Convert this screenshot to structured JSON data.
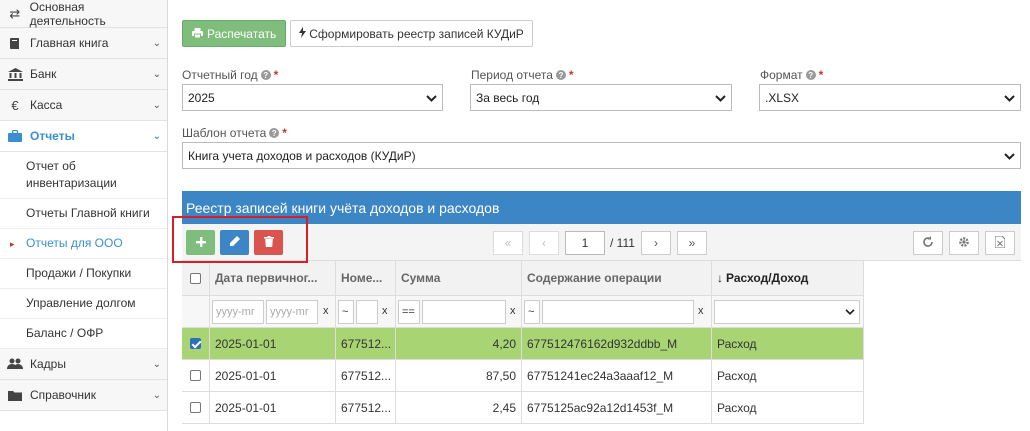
{
  "sidebar": {
    "top": {
      "label": "Основная деятельность",
      "icon": "transfer-arrows-icon"
    },
    "items": [
      {
        "label": "Главная книга",
        "icon": "book-icon"
      },
      {
        "label": "Банк",
        "icon": "bank-icon"
      },
      {
        "label": "Касса",
        "icon": "euro-icon"
      },
      {
        "label": "Отчеты",
        "icon": "briefcase-icon"
      }
    ],
    "subitems": [
      {
        "label": "Отчет об инвентаризации"
      },
      {
        "label": "Отчеты Главной книги"
      },
      {
        "label": "Отчеты для ООО"
      },
      {
        "label": "Продажи / Покупки"
      },
      {
        "label": "Управление долгом"
      },
      {
        "label": "Баланс / ОФР"
      }
    ],
    "bottom": [
      {
        "label": "Кадры",
        "icon": "users-icon"
      },
      {
        "label": "Справочник",
        "icon": "folder-icon"
      }
    ]
  },
  "toolbar": {
    "print_label": "Распечатать",
    "generate_label": "Сформировать реестр записей КУДиР"
  },
  "form": {
    "year_label": "Отчетный год",
    "year_value": "2025",
    "period_label": "Период отчета",
    "period_value": "За весь год",
    "format_label": "Формат",
    "format_value": ".XLSX",
    "template_label": "Шаблон отчета",
    "template_value": "Книга учета доходов и расходов (КУДиР)",
    "required_mark": "*",
    "help_mark": "?"
  },
  "grid": {
    "title": "Реестр записей книги учёта доходов и расходов",
    "page_current": "1",
    "page_total": "/ 111",
    "pager": {
      "first": "«",
      "prev": "‹",
      "next": "›",
      "last": "»"
    },
    "columns": [
      "Дата первичног...",
      "Номе...",
      "Сумма",
      "Содержание операции",
      "Расход/Доход"
    ],
    "sort_arrow": "↓",
    "filters": {
      "date_from_placeholder": "yyyy-mr",
      "date_to_placeholder": "yyyy-mr",
      "clear": "x",
      "number_op": "~",
      "sum_op": "==",
      "content_op": "~"
    },
    "rows": [
      {
        "date": "2025-01-01",
        "number": "677512...",
        "sum": "4,20",
        "content": "677512476162d932ddbb_M",
        "type": "Расход",
        "checked": true
      },
      {
        "date": "2025-01-01",
        "number": "677512...",
        "sum": "87,50",
        "content": "67751241ec24a3aaaf12_M",
        "type": "Расход",
        "checked": false
      },
      {
        "date": "2025-01-01",
        "number": "677512...",
        "sum": "2,45",
        "content": "6775125ac92a12d1453f_M",
        "type": "Расход",
        "checked": false
      }
    ]
  },
  "colors": {
    "accent_blue": "#3d86c6",
    "green": "#7fbd7c",
    "red": "#d9534f",
    "selected_row": "#a8d474",
    "highlight_frame": "#d81f26"
  }
}
